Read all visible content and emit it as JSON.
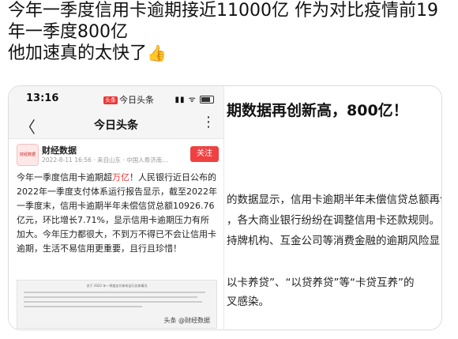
{
  "post": {
    "line1": "今年一季度信用卡逾期接近11000亿 作为对比疫情前19",
    "line2": "年一季度800亿",
    "line3": "他加速真的太快了"
  },
  "thumbs_icon": "thumbs-up-emoji",
  "phone": {
    "time": "13:16",
    "app_badge": "头条",
    "app_name": "今日头条",
    "status_icons": "▮▮ ᯤ",
    "nav_back": "〈",
    "nav_title": "今日头条",
    "nav_more": "⋮",
    "author_name": "财经数据",
    "author_meta": "2022-8-11 16:56 · 来自山东 · 中国人寿济南…",
    "avatar_text": "财经数据",
    "follow_label": "关注",
    "body_part1": "今年一季度信用卡逾期超",
    "body_highlight": "万亿",
    "body_part2": "！人民银行近日公布的2022年一季度支付体系运行报告显示，截至2022年一季度末，信用卡逾期半年未偿信贷总额10926.76亿元，环比增长7.71%，显示信用卡逾期压力有所加大。今年压力都很大，不到万不得已不会让信用卡逾期，生活不易信用更重要，且行且珍惜！",
    "doc_title": "关于 2022 年一季度支付体系运行总体情况",
    "watermark": "头条 @财经数据"
  },
  "right": {
    "headline": "期数据再创新高，800亿！",
    "body_lines": [
      "的数据显示，信用卡逾期半年未偿信贷总额再创",
      "，各大商业银行纷纷在调整信用卡还款规则。",
      "持牌机构、互金公司等消费金融的逾期风险显"
    ],
    "body_lines2": [
      "以卡养贷”、“以贷养贷”等“卡贷互养”的",
      "叉感染。"
    ]
  },
  "colors": {
    "accent_red": "#f04142",
    "highlight_red": "#e33333"
  }
}
